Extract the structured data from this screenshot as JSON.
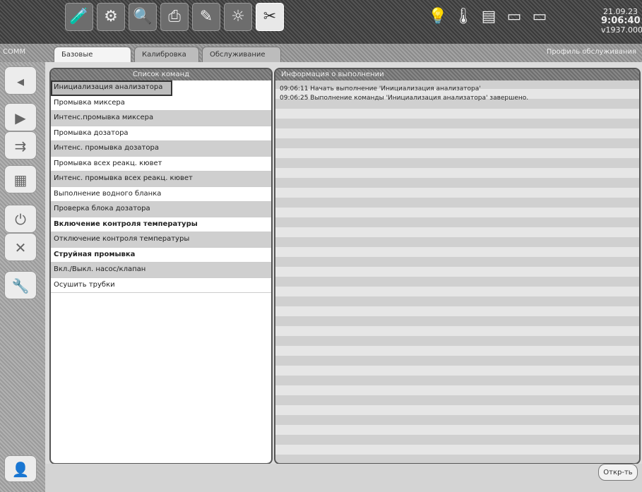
{
  "toolbar": {
    "icons": [
      {
        "name": "test-tube-icon",
        "glyph": "🧪"
      },
      {
        "name": "gear-icon",
        "glyph": "⚙"
      },
      {
        "name": "search-document-icon",
        "glyph": "🔍"
      },
      {
        "name": "printer-icon",
        "glyph": "⎙"
      },
      {
        "name": "edit-icon",
        "glyph": "✎"
      },
      {
        "name": "settings-icon",
        "glyph": "☼"
      },
      {
        "name": "tools-icon",
        "glyph": "✂"
      }
    ],
    "right_icons": [
      {
        "name": "bulb-icon",
        "glyph": "💡"
      },
      {
        "name": "thermometer-icon",
        "glyph": "🌡"
      },
      {
        "name": "tray-icon",
        "glyph": "▤"
      },
      {
        "name": "tray-empty-icon",
        "glyph": "▭"
      },
      {
        "name": "tray-alt-icon",
        "glyph": "▭"
      }
    ],
    "clock_top": "21.09.23",
    "clock_time": "9:06:40",
    "clock_bottom": "v1937.000"
  },
  "comm_label": "COMM",
  "tabs": [
    {
      "label": "Базовые команды",
      "active": true
    },
    {
      "label": "Калибровка ISE",
      "active": false
    },
    {
      "label": "Обслуживание ISE",
      "active": false
    }
  ],
  "profile_link": "Профиль обслуживания",
  "side_buttons": [
    {
      "name": "back-icon",
      "glyph": "◂"
    },
    {
      "name": "play-icon",
      "glyph": "▶"
    },
    {
      "name": "step-icon",
      "glyph": "⇉"
    },
    {
      "name": "grid-icon",
      "glyph": "▦"
    },
    {
      "name": "power-icon",
      "glyph": "⏻"
    },
    {
      "name": "close-icon",
      "glyph": "✕"
    },
    {
      "name": "wrench-icon",
      "glyph": "🔧"
    }
  ],
  "user_button": {
    "name": "user-icon",
    "glyph": "👤"
  },
  "command_panel": {
    "header": "Список команд",
    "items": [
      {
        "label": "Инициализация анализатора",
        "shade": true,
        "bold": false,
        "selected": true
      },
      {
        "label": "Промывка миксера",
        "shade": false,
        "bold": false,
        "selected": false
      },
      {
        "label": "Интенс.промывка миксера",
        "shade": true,
        "bold": false,
        "selected": false
      },
      {
        "label": "Промывка дозатора",
        "shade": false,
        "bold": false,
        "selected": false
      },
      {
        "label": "Интенс. промывка дозатора",
        "shade": true,
        "bold": false,
        "selected": false
      },
      {
        "label": "Промывка всех реакц. кювет",
        "shade": false,
        "bold": false,
        "selected": false
      },
      {
        "label": "Интенс. промывка всех реакц. кювет",
        "shade": true,
        "bold": false,
        "selected": false
      },
      {
        "label": "Выполнение водного бланка",
        "shade": false,
        "bold": false,
        "selected": false
      },
      {
        "label": "Проверка блока дозатора",
        "shade": true,
        "bold": false,
        "selected": false
      },
      {
        "label": "Включение контроля температуры",
        "shade": false,
        "bold": true,
        "selected": false
      },
      {
        "label": "Отключение контроля температуры",
        "shade": true,
        "bold": false,
        "selected": false
      },
      {
        "label": "Струйная промывка",
        "shade": false,
        "bold": true,
        "selected": false
      },
      {
        "label": "Вкл./Выкл. насос/клапан",
        "shade": true,
        "bold": false,
        "selected": false
      },
      {
        "label": "Осушить трубки",
        "shade": false,
        "bold": false,
        "selected": false
      }
    ]
  },
  "info_panel": {
    "header": "Информация о выполнении",
    "log": [
      "09:06:11 Начать выполнение 'Инициализация анализатора'",
      "09:06:25 Выполнение команды 'Инициализация анализатора' завершено."
    ]
  },
  "open_button": "Откр-ть"
}
